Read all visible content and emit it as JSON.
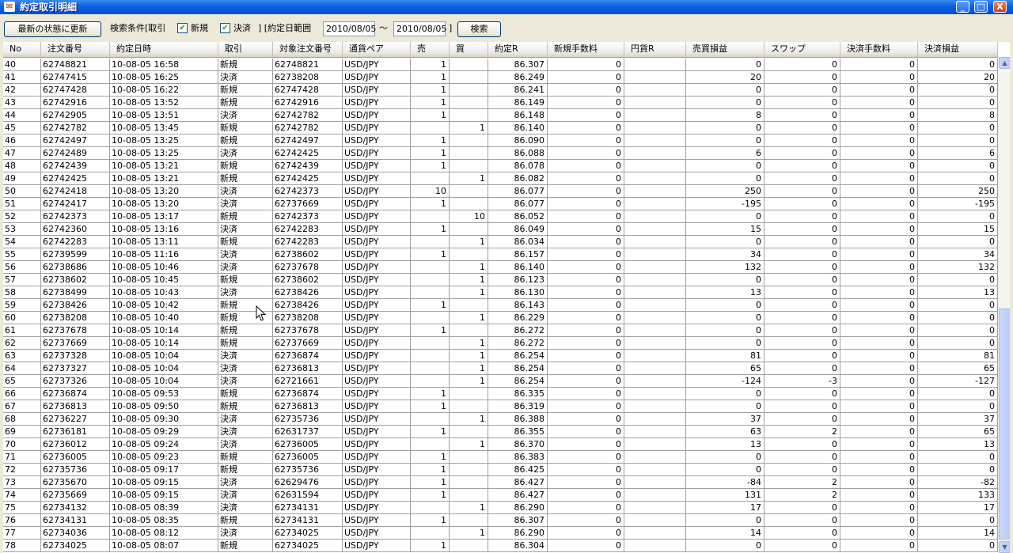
{
  "window": {
    "title": "約定取引明細",
    "app_icon": "app-icon",
    "controls": {
      "minimize": "_",
      "maximize": "□",
      "close": "X"
    }
  },
  "toolbar": {
    "refresh_label": "最新の状態に更新",
    "filter_prefix": "検索条件[取引",
    "checkbox_new_label": "新規",
    "checkbox_new_checked": true,
    "checkbox_settle_label": "決済",
    "checkbox_settle_checked": true,
    "date_range_label": "] [約定日範囲",
    "date_from": "2010/08/05",
    "tilde": "～",
    "date_to": "2010/08/05",
    "close_bracket": "]",
    "search_label": "検索"
  },
  "table": {
    "columns": [
      "No",
      "注文番号",
      "約定日時",
      "取引",
      "対象注文番号",
      "通貨ペア",
      "売",
      "買",
      "約定R",
      "新規手数料",
      "円貨R",
      "売買損益",
      "スワップ",
      "決済手数料",
      "決済損益"
    ],
    "rows": [
      [
        "40",
        "62748821",
        "10-08-05 16:58",
        "新規",
        "62748821",
        "USD/JPY",
        "1",
        "",
        "86.307",
        "0",
        "",
        "0",
        "0",
        "0",
        "0"
      ],
      [
        "41",
        "62747415",
        "10-08-05 16:25",
        "決済",
        "62738208",
        "USD/JPY",
        "1",
        "",
        "86.249",
        "0",
        "",
        "20",
        "0",
        "0",
        "20"
      ],
      [
        "42",
        "62747428",
        "10-08-05 16:22",
        "新規",
        "62747428",
        "USD/JPY",
        "1",
        "",
        "86.241",
        "0",
        "",
        "0",
        "0",
        "0",
        "0"
      ],
      [
        "43",
        "62742916",
        "10-08-05 13:52",
        "新規",
        "62742916",
        "USD/JPY",
        "1",
        "",
        "86.149",
        "0",
        "",
        "0",
        "0",
        "0",
        "0"
      ],
      [
        "44",
        "62742905",
        "10-08-05 13:51",
        "決済",
        "62742782",
        "USD/JPY",
        "1",
        "",
        "86.148",
        "0",
        "",
        "8",
        "0",
        "0",
        "8"
      ],
      [
        "45",
        "62742782",
        "10-08-05 13:45",
        "新規",
        "62742782",
        "USD/JPY",
        "",
        "1",
        "86.140",
        "0",
        "",
        "0",
        "0",
        "0",
        "0"
      ],
      [
        "46",
        "62742497",
        "10-08-05 13:25",
        "新規",
        "62742497",
        "USD/JPY",
        "1",
        "",
        "86.090",
        "0",
        "",
        "0",
        "0",
        "0",
        "0"
      ],
      [
        "47",
        "62742489",
        "10-08-05 13:25",
        "決済",
        "62742425",
        "USD/JPY",
        "1",
        "",
        "86.088",
        "0",
        "",
        "6",
        "0",
        "0",
        "6"
      ],
      [
        "48",
        "62742439",
        "10-08-05 13:21",
        "新規",
        "62742439",
        "USD/JPY",
        "1",
        "",
        "86.078",
        "0",
        "",
        "0",
        "0",
        "0",
        "0"
      ],
      [
        "49",
        "62742425",
        "10-08-05 13:21",
        "新規",
        "62742425",
        "USD/JPY",
        "",
        "1",
        "86.082",
        "0",
        "",
        "0",
        "0",
        "0",
        "0"
      ],
      [
        "50",
        "62742418",
        "10-08-05 13:20",
        "決済",
        "62742373",
        "USD/JPY",
        "10",
        "",
        "86.077",
        "0",
        "",
        "250",
        "0",
        "0",
        "250"
      ],
      [
        "51",
        "62742417",
        "10-08-05 13:20",
        "決済",
        "62737669",
        "USD/JPY",
        "1",
        "",
        "86.077",
        "0",
        "",
        "-195",
        "0",
        "0",
        "-195"
      ],
      [
        "52",
        "62742373",
        "10-08-05 13:17",
        "新規",
        "62742373",
        "USD/JPY",
        "",
        "10",
        "86.052",
        "0",
        "",
        "0",
        "0",
        "0",
        "0"
      ],
      [
        "53",
        "62742360",
        "10-08-05 13:16",
        "決済",
        "62742283",
        "USD/JPY",
        "1",
        "",
        "86.049",
        "0",
        "",
        "15",
        "0",
        "0",
        "15"
      ],
      [
        "54",
        "62742283",
        "10-08-05 13:11",
        "新規",
        "62742283",
        "USD/JPY",
        "",
        "1",
        "86.034",
        "0",
        "",
        "0",
        "0",
        "0",
        "0"
      ],
      [
        "55",
        "62739599",
        "10-08-05 11:16",
        "決済",
        "62738602",
        "USD/JPY",
        "1",
        "",
        "86.157",
        "0",
        "",
        "34",
        "0",
        "0",
        "34"
      ],
      [
        "56",
        "62738686",
        "10-08-05 10:46",
        "決済",
        "62737678",
        "USD/JPY",
        "",
        "1",
        "86.140",
        "0",
        "",
        "132",
        "0",
        "0",
        "132"
      ],
      [
        "57",
        "62738602",
        "10-08-05 10:45",
        "新規",
        "62738602",
        "USD/JPY",
        "",
        "1",
        "86.123",
        "0",
        "",
        "0",
        "0",
        "0",
        "0"
      ],
      [
        "58",
        "62738499",
        "10-08-05 10:43",
        "決済",
        "62738426",
        "USD/JPY",
        "",
        "1",
        "86.130",
        "0",
        "",
        "13",
        "0",
        "0",
        "13"
      ],
      [
        "59",
        "62738426",
        "10-08-05 10:42",
        "新規",
        "62738426",
        "USD/JPY",
        "1",
        "",
        "86.143",
        "0",
        "",
        "0",
        "0",
        "0",
        "0"
      ],
      [
        "60",
        "62738208",
        "10-08-05 10:40",
        "新規",
        "62738208",
        "USD/JPY",
        "",
        "1",
        "86.229",
        "0",
        "",
        "0",
        "0",
        "0",
        "0"
      ],
      [
        "61",
        "62737678",
        "10-08-05 10:14",
        "新規",
        "62737678",
        "USD/JPY",
        "1",
        "",
        "86.272",
        "0",
        "",
        "0",
        "0",
        "0",
        "0"
      ],
      [
        "62",
        "62737669",
        "10-08-05 10:14",
        "新規",
        "62737669",
        "USD/JPY",
        "",
        "1",
        "86.272",
        "0",
        "",
        "0",
        "0",
        "0",
        "0"
      ],
      [
        "63",
        "62737328",
        "10-08-05 10:04",
        "決済",
        "62736874",
        "USD/JPY",
        "",
        "1",
        "86.254",
        "0",
        "",
        "81",
        "0",
        "0",
        "81"
      ],
      [
        "64",
        "62737327",
        "10-08-05 10:04",
        "決済",
        "62736813",
        "USD/JPY",
        "",
        "1",
        "86.254",
        "0",
        "",
        "65",
        "0",
        "0",
        "65"
      ],
      [
        "65",
        "62737326",
        "10-08-05 10:04",
        "決済",
        "62721661",
        "USD/JPY",
        "",
        "1",
        "86.254",
        "0",
        "",
        "-124",
        "-3",
        "0",
        "-127"
      ],
      [
        "66",
        "62736874",
        "10-08-05 09:53",
        "新規",
        "62736874",
        "USD/JPY",
        "1",
        "",
        "86.335",
        "0",
        "",
        "0",
        "0",
        "0",
        "0"
      ],
      [
        "67",
        "62736813",
        "10-08-05 09:50",
        "新規",
        "62736813",
        "USD/JPY",
        "1",
        "",
        "86.319",
        "0",
        "",
        "0",
        "0",
        "0",
        "0"
      ],
      [
        "68",
        "62736227",
        "10-08-05 09:30",
        "決済",
        "62735736",
        "USD/JPY",
        "",
        "1",
        "86.388",
        "0",
        "",
        "37",
        "0",
        "0",
        "37"
      ],
      [
        "69",
        "62736181",
        "10-08-05 09:29",
        "決済",
        "62631737",
        "USD/JPY",
        "1",
        "",
        "86.355",
        "0",
        "",
        "63",
        "2",
        "0",
        "65"
      ],
      [
        "70",
        "62736012",
        "10-08-05 09:24",
        "決済",
        "62736005",
        "USD/JPY",
        "",
        "1",
        "86.370",
        "0",
        "",
        "13",
        "0",
        "0",
        "13"
      ],
      [
        "71",
        "62736005",
        "10-08-05 09:23",
        "新規",
        "62736005",
        "USD/JPY",
        "1",
        "",
        "86.383",
        "0",
        "",
        "0",
        "0",
        "0",
        "0"
      ],
      [
        "72",
        "62735736",
        "10-08-05 09:17",
        "新規",
        "62735736",
        "USD/JPY",
        "1",
        "",
        "86.425",
        "0",
        "",
        "0",
        "0",
        "0",
        "0"
      ],
      [
        "73",
        "62735670",
        "10-08-05 09:15",
        "決済",
        "62629476",
        "USD/JPY",
        "1",
        "",
        "86.427",
        "0",
        "",
        "-84",
        "2",
        "0",
        "-82"
      ],
      [
        "74",
        "62735669",
        "10-08-05 09:15",
        "決済",
        "62631594",
        "USD/JPY",
        "1",
        "",
        "86.427",
        "0",
        "",
        "131",
        "2",
        "0",
        "133"
      ],
      [
        "75",
        "62734132",
        "10-08-05 08:39",
        "決済",
        "62734131",
        "USD/JPY",
        "",
        "1",
        "86.290",
        "0",
        "",
        "17",
        "0",
        "0",
        "17"
      ],
      [
        "76",
        "62734131",
        "10-08-05 08:35",
        "新規",
        "62734131",
        "USD/JPY",
        "1",
        "",
        "86.307",
        "0",
        "",
        "0",
        "0",
        "0",
        "0"
      ],
      [
        "77",
        "62734036",
        "10-08-05 08:12",
        "決済",
        "62734025",
        "USD/JPY",
        "",
        "1",
        "86.290",
        "0",
        "",
        "14",
        "0",
        "0",
        "14"
      ],
      [
        "78",
        "62734025",
        "10-08-05 08:07",
        "新規",
        "62734025",
        "USD/JPY",
        "1",
        "",
        "86.304",
        "0",
        "",
        "0",
        "0",
        "0",
        "0"
      ]
    ]
  },
  "scrollbar": {
    "up_arrow": "▲",
    "down_arrow": "▼"
  },
  "colors": {
    "titlebar": "#0a5fe0",
    "window_bg": "#ece9d8",
    "grid_line": "#a0a0a0"
  }
}
